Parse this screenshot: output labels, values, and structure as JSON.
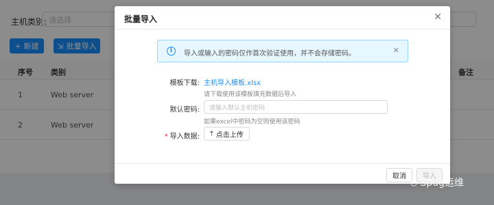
{
  "filter": {
    "label": "主机类别:",
    "placeholder": "请选择"
  },
  "toolbar": {
    "new_label": "新建",
    "import_label": "批量导入"
  },
  "table": {
    "headers": [
      "序号",
      "类别",
      "备注"
    ],
    "rows": [
      {
        "index": "1",
        "category": "Web server"
      },
      {
        "index": "2",
        "category": "Web server"
      }
    ]
  },
  "modal": {
    "title": "批量导入",
    "alert": "导入或输入的密码仅作首次验证使用，并不会存储密码。",
    "template_label": "模板下载:",
    "template_link": "主机导入模板.xlsx",
    "template_help": "请下载使用该模板填充数据后导入",
    "password_label": "默认密码:",
    "password_placeholder": "请输入默认主机密码",
    "password_help": "如果excel中密码为空则使用该密码",
    "data_label": "导入数据:",
    "upload_label": "点击上传",
    "cancel_label": "取消",
    "ok_label": "导入"
  },
  "watermark": "Spug运维"
}
